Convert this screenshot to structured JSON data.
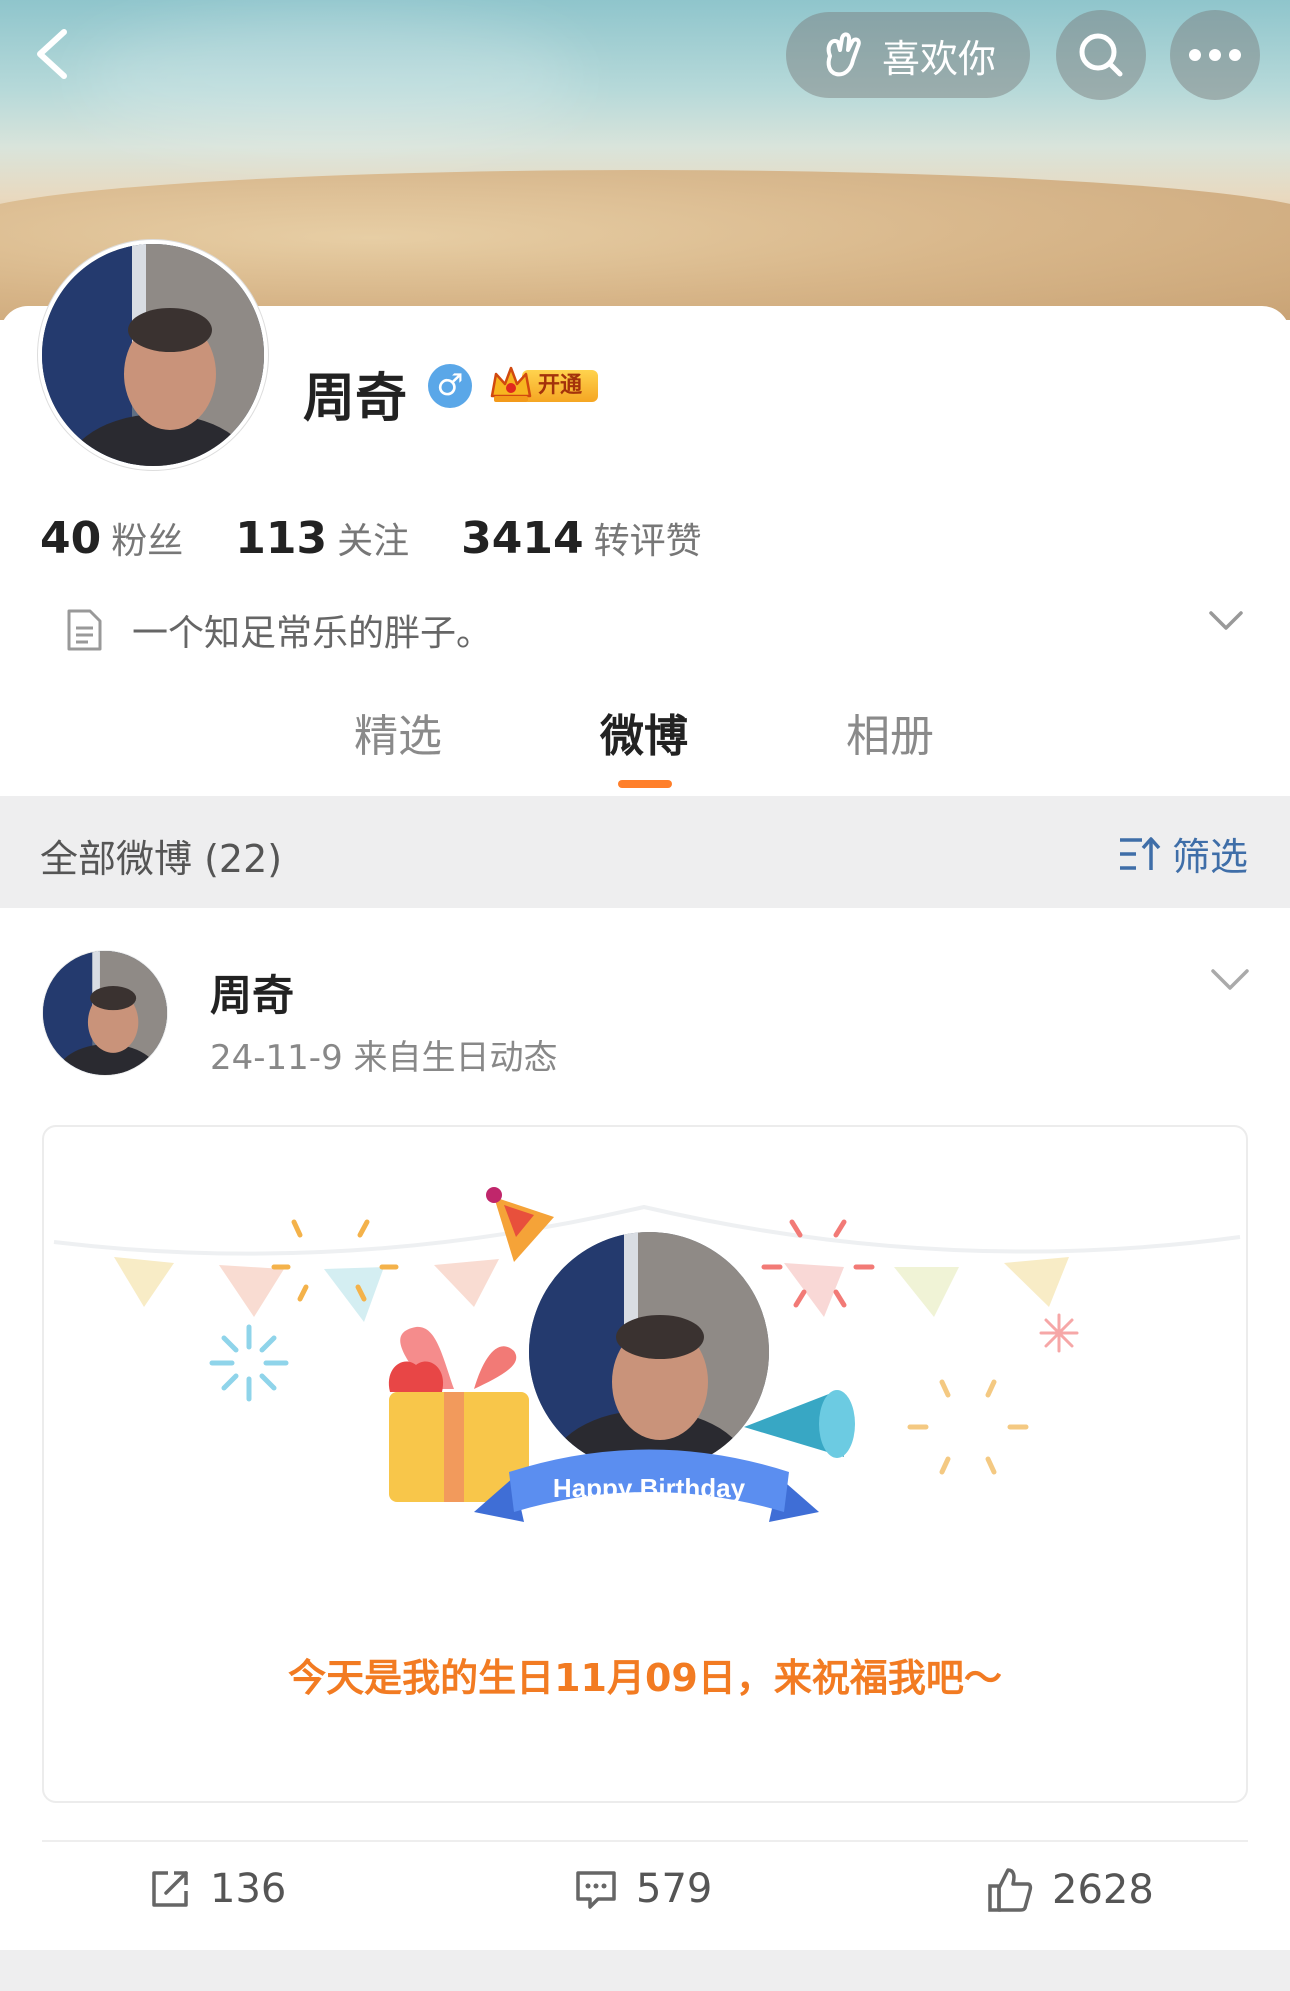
{
  "header": {
    "like_button_label": "喜欢你"
  },
  "profile": {
    "name": "周奇",
    "gender_symbol": "♂",
    "vip_label": "开通",
    "stats": [
      {
        "value": "40",
        "label": "粉丝"
      },
      {
        "value": "113",
        "label": "关注"
      },
      {
        "value": "3414",
        "label": "转评赞"
      }
    ],
    "bio": "一个知足常乐的胖子。"
  },
  "tabs": [
    {
      "label": "精选",
      "active": false
    },
    {
      "label": "微博",
      "active": true
    },
    {
      "label": "相册",
      "active": false
    }
  ],
  "feed": {
    "all_label": "全部微博 (22)",
    "filter_label": "筛选"
  },
  "post": {
    "author": "周奇",
    "meta": "24-11-9  来自生日动态",
    "card": {
      "banner_text": "Happy Birthday",
      "wish_text": "今天是我的生日11月09日，来祝福我吧～"
    },
    "actions": {
      "repost_count": "136",
      "comment_count": "579",
      "like_count": "2628"
    }
  },
  "colors": {
    "accent": "#ff7f2a",
    "link_blue": "#3f6ea8",
    "wish_orange": "#f27b22"
  }
}
